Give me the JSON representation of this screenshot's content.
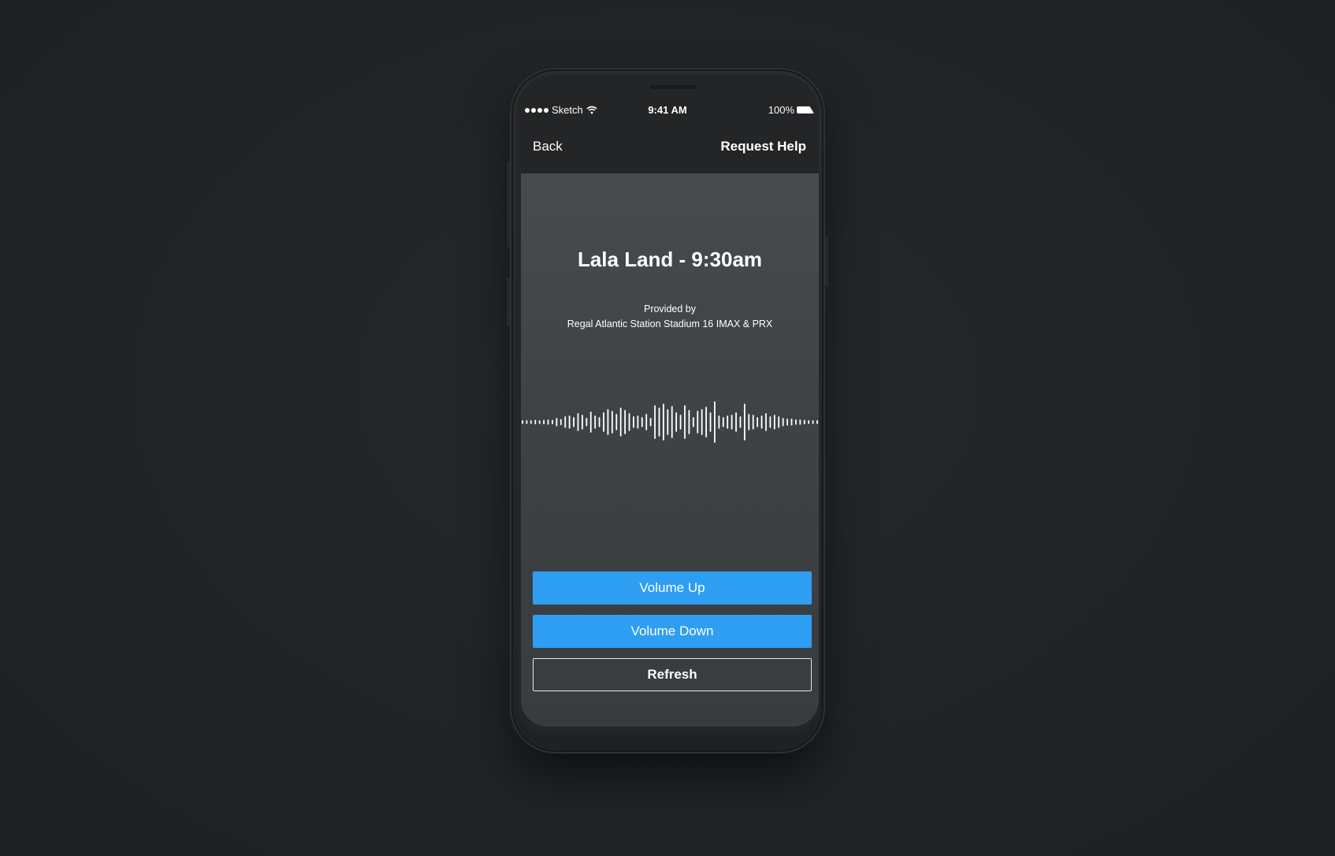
{
  "status_bar": {
    "carrier": "Sketch",
    "time": "9:41 AM",
    "battery": "100%"
  },
  "nav": {
    "back_label": "Back",
    "help_label": "Request Help"
  },
  "main": {
    "title": "Lala Land - 9:30am",
    "provided_by": "Provided by",
    "provider_name": "Regal Atlantic Station Stadium 16 IMAX & PRX"
  },
  "buttons": {
    "volume_up": "Volume Up",
    "volume_down": "Volume Down",
    "refresh": "Refresh"
  },
  "colors": {
    "accent": "#2e9ef2",
    "background": "#222527",
    "content_bg": "#424548"
  },
  "icons": {
    "signal": "signal-dots-icon",
    "wifi": "wifi-icon",
    "battery": "battery-icon",
    "waveform": "audio-waveform-icon"
  }
}
